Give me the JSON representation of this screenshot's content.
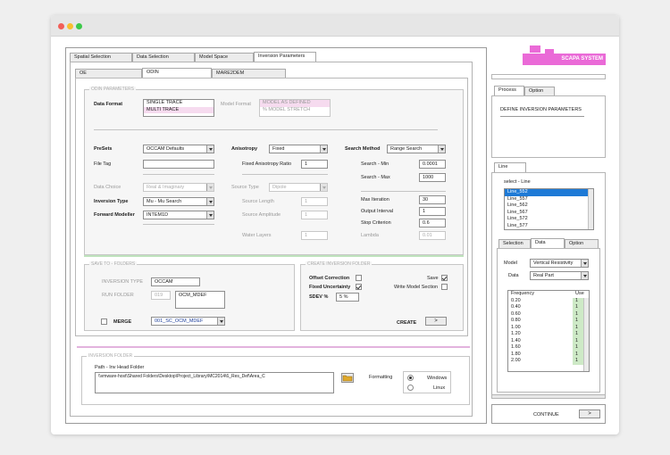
{
  "window": {
    "controls": [
      "close",
      "minimize",
      "maximize"
    ]
  },
  "top_tabs": [
    {
      "label": "Spatial Selection"
    },
    {
      "label": "Data Selection"
    },
    {
      "label": "Model Space"
    },
    {
      "label": "Inversion Parameters"
    }
  ],
  "sub_tabs": [
    {
      "label": "OE"
    },
    {
      "label": "ODIN"
    },
    {
      "label": "MARE2DEM"
    }
  ],
  "odin": {
    "group_label": "ODIN PARAMETERS",
    "data_format": {
      "label": "Data Format",
      "options": [
        "SINGLE TRACE",
        "MULTI TRACE"
      ]
    },
    "model_format": {
      "label": "Model Format",
      "options": [
        "MODEL AS DEFINED",
        "% MODEL STRETCH"
      ]
    },
    "presets": {
      "label": "PreSets",
      "value": "OCCAM Defaults"
    },
    "anisotropy": {
      "label": "Anisotropy",
      "value": "Fixed"
    },
    "search_method": {
      "label": "Search Method",
      "value": "Range Search"
    },
    "file_tag": {
      "label": "File Tag",
      "value": ""
    },
    "fixed_anisotropy_ratio": {
      "label": "Fixed Anisotropy Ratio",
      "value": "1"
    },
    "search_min": {
      "label": "Search - Min",
      "value": "0.0001"
    },
    "search_max": {
      "label": "Search - Max",
      "value": "1000"
    },
    "data_choice": {
      "label": "Data Choice",
      "value": "Real & Imaginary"
    },
    "source_type": {
      "label": "Source Type",
      "value": "Dipole"
    },
    "inversion_type": {
      "label": "Inversion Type",
      "value": "Mu - Mu Search"
    },
    "source_length": {
      "label": "Source Length",
      "value": "1"
    },
    "max_iteration": {
      "label": "Max Iteration",
      "value": "30"
    },
    "forward_modeller": {
      "label": "Forward Modeller",
      "value": "INTEM1D"
    },
    "source_amplitude": {
      "label": "Source Amplitude",
      "value": "1"
    },
    "output_interval": {
      "label": "Output Interval",
      "value": "1"
    },
    "stop_criterion": {
      "label": "Stop Criterion",
      "value": "0.6"
    },
    "water_layers": {
      "label": "Water Layers",
      "value": "1"
    },
    "lambda": {
      "label": "Lambda",
      "value": "0.01"
    }
  },
  "save_to_folders": {
    "group_label": "SAVE TO - FOLDERS",
    "inversion_type": {
      "label": "INVERSION TYPE",
      "value": "OCCAM"
    },
    "run_folder": {
      "label": "RUN FOLDER",
      "number": "019",
      "value": "OCM_MDEF"
    },
    "merge": {
      "label": "MERGE",
      "value": "001_SC_OCM_MDEF"
    }
  },
  "create_inversion_folder": {
    "group_label": "CREATE INVERSION FOLDER",
    "offset_correction": "Offset Correction",
    "fixed_uncertainty": "Fixed Uncertainty",
    "sdev_label": "SDEV %",
    "sdev_value": "5 %",
    "save": "Save",
    "write_model_section": "Write Model Section",
    "create": "CREATE",
    "create_btn": ">"
  },
  "inversion_folder": {
    "group_label": "INVERSION FOLDER",
    "path_label": "Path - Inv Head Folder",
    "path": "\\\\vmware-host\\Shared Folders\\Desktop\\Project_Library\\MC2014\\6_Res_Def\\Area_C",
    "formatting_label": "Formatting",
    "options": [
      "Windows",
      "Linux"
    ]
  },
  "brand": {
    "name": "SCAPA SYSTEM",
    "color": "#ea6ad7"
  },
  "process": {
    "tabs": [
      "Process",
      "Option"
    ],
    "text": "DEFINE INVERSION PARAMETERS"
  },
  "line": {
    "tab": "Line",
    "select_label": "select - Line",
    "items": [
      "Line_552",
      "Line_557",
      "Line_562",
      "Line_567",
      "Line_572",
      "Line_577"
    ]
  },
  "data_panel": {
    "tabs": [
      "Selection",
      "Data",
      "Option"
    ],
    "model_label": "Model",
    "model_value": "Vertical Resistivity",
    "data_label": "Data",
    "data_value": "Real Part",
    "freq_header": "Frequency",
    "use_header": "Use",
    "rows": [
      {
        "f": "0.20",
        "u": "1"
      },
      {
        "f": "0.40",
        "u": "1"
      },
      {
        "f": "0.60",
        "u": "1"
      },
      {
        "f": "0.80",
        "u": "1"
      },
      {
        "f": "1.00",
        "u": "1"
      },
      {
        "f": "1.20",
        "u": "1"
      },
      {
        "f": "1.40",
        "u": "1"
      },
      {
        "f": "1.60",
        "u": "1"
      },
      {
        "f": "1.80",
        "u": "1"
      },
      {
        "f": "2.00",
        "u": "1"
      }
    ]
  },
  "continue": {
    "label": "CONTINUE",
    "btn": ">"
  }
}
